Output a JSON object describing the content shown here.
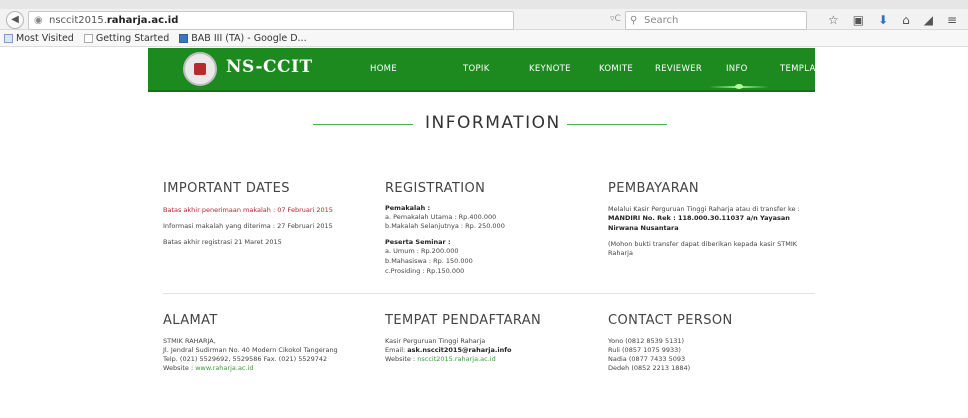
{
  "browser": {
    "url_prefix": "nsccit2015.",
    "url_domain": "raharja.ac.id",
    "search_placeholder": "Search",
    "bookmarks": [
      "Most Visited",
      "Getting Started",
      "BAB III (TA) - Google D..."
    ]
  },
  "site": {
    "logo_text": "NS-CCIT",
    "nav": [
      "HOME",
      "TOPIK",
      "KEYNOTE",
      "KOMITE",
      "REVIEWER",
      "INFO",
      "TEMPLATE"
    ],
    "active_nav": "INFO"
  },
  "page": {
    "heading": "INFORMATION"
  },
  "important_dates": {
    "title": "IMPORTANT DATES",
    "lines": [
      "Batas akhir penerimaan makalah : 07 Februari 2015",
      "Informasi makalah yang diterima : 27 Februari 2015",
      "Batas akhir registrasi 21 Maret 2015"
    ]
  },
  "registration": {
    "title": "REGISTRATION",
    "pemakalah_label": "Pemakalah :",
    "pemakalah": [
      "a. Pemakalah Utama : Rp.400.000",
      "b.Makalah Selanjutnya : Rp. 250.000"
    ],
    "peserta_label": "Peserta Seminar :",
    "peserta": [
      "a. Umum : Rp.200.000",
      "b.Mahasiswa : Rp. 150.000",
      "c.Prosiding : Rp.150.000"
    ]
  },
  "pembayaran": {
    "title": "PEMBAYARAN",
    "line1": "Melalui Kasir Perguruan Tinggi Raharja atau di transfer ke :",
    "line2": "MANDIRI No. Rek : 118.000.30.11037 a/n Yayasan",
    "line3": "Nirwana Nusantara",
    "line4": "(Mohon bukti transfer dapat diberikan kepada kasir STMIK",
    "line5": "Raharja"
  },
  "alamat": {
    "title": "ALAMAT",
    "lines": [
      "STMIK RAHARJA,",
      "Jl. Jendral Sudirman No. 40 Modern Cikokol Tangerang",
      "Telp. (021) 5529692, 5529586 Fax. (021) 5529742"
    ],
    "website_label": "Website : ",
    "website": "www.raharja.ac.id"
  },
  "tempat": {
    "title": "TEMPAT PENDAFTARAN",
    "line1": "Kasir Perguruan Tinggi Raharja",
    "email_label": "Email: ",
    "email": "ask.nsccit2015@raharja.info",
    "website_label": "Website : ",
    "website": "nsccit2015.raharja.ac.id"
  },
  "contact": {
    "title": "CONTACT PERSON",
    "lines": [
      "Yono (0812 8539 5131)",
      "Ruli (0857 1075 9933)",
      "Nadia (0877 7433 5093",
      "Dedeh (0852 2213 1884)"
    ]
  }
}
